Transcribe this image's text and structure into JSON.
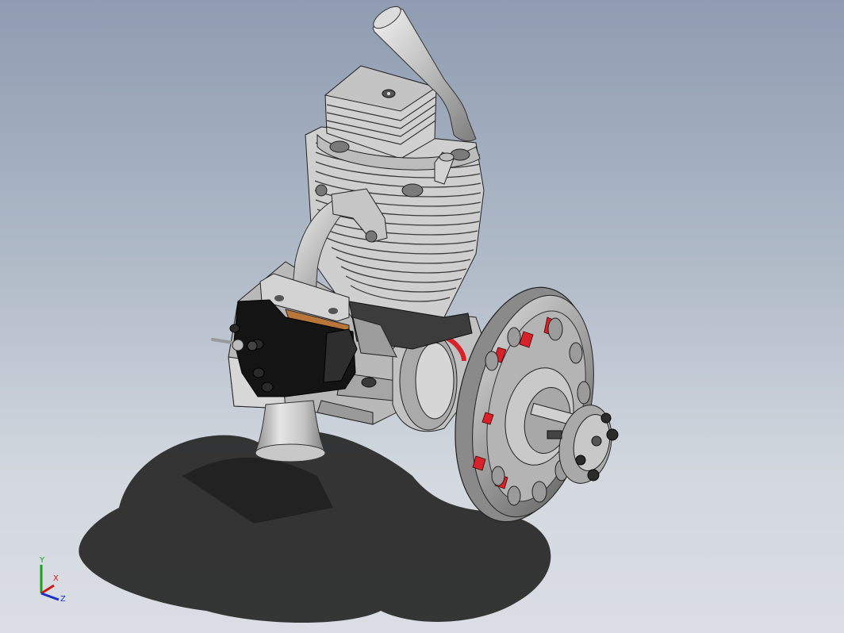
{
  "viewport": {
    "background_top": "#8f9cb1",
    "background_bottom": "#dadee4"
  },
  "model": {
    "body_color": "#c9c9c9",
    "dark_color": "#2a2a2a",
    "accent_red": "#d8222a",
    "gasket_color": "#b8763a",
    "black_part": "#111111"
  },
  "triad": {
    "x_label": "X",
    "y_label": "Y",
    "z_label": "Z",
    "x_color": "#d01818",
    "y_color": "#1aa01a",
    "z_color": "#1a30c8"
  }
}
